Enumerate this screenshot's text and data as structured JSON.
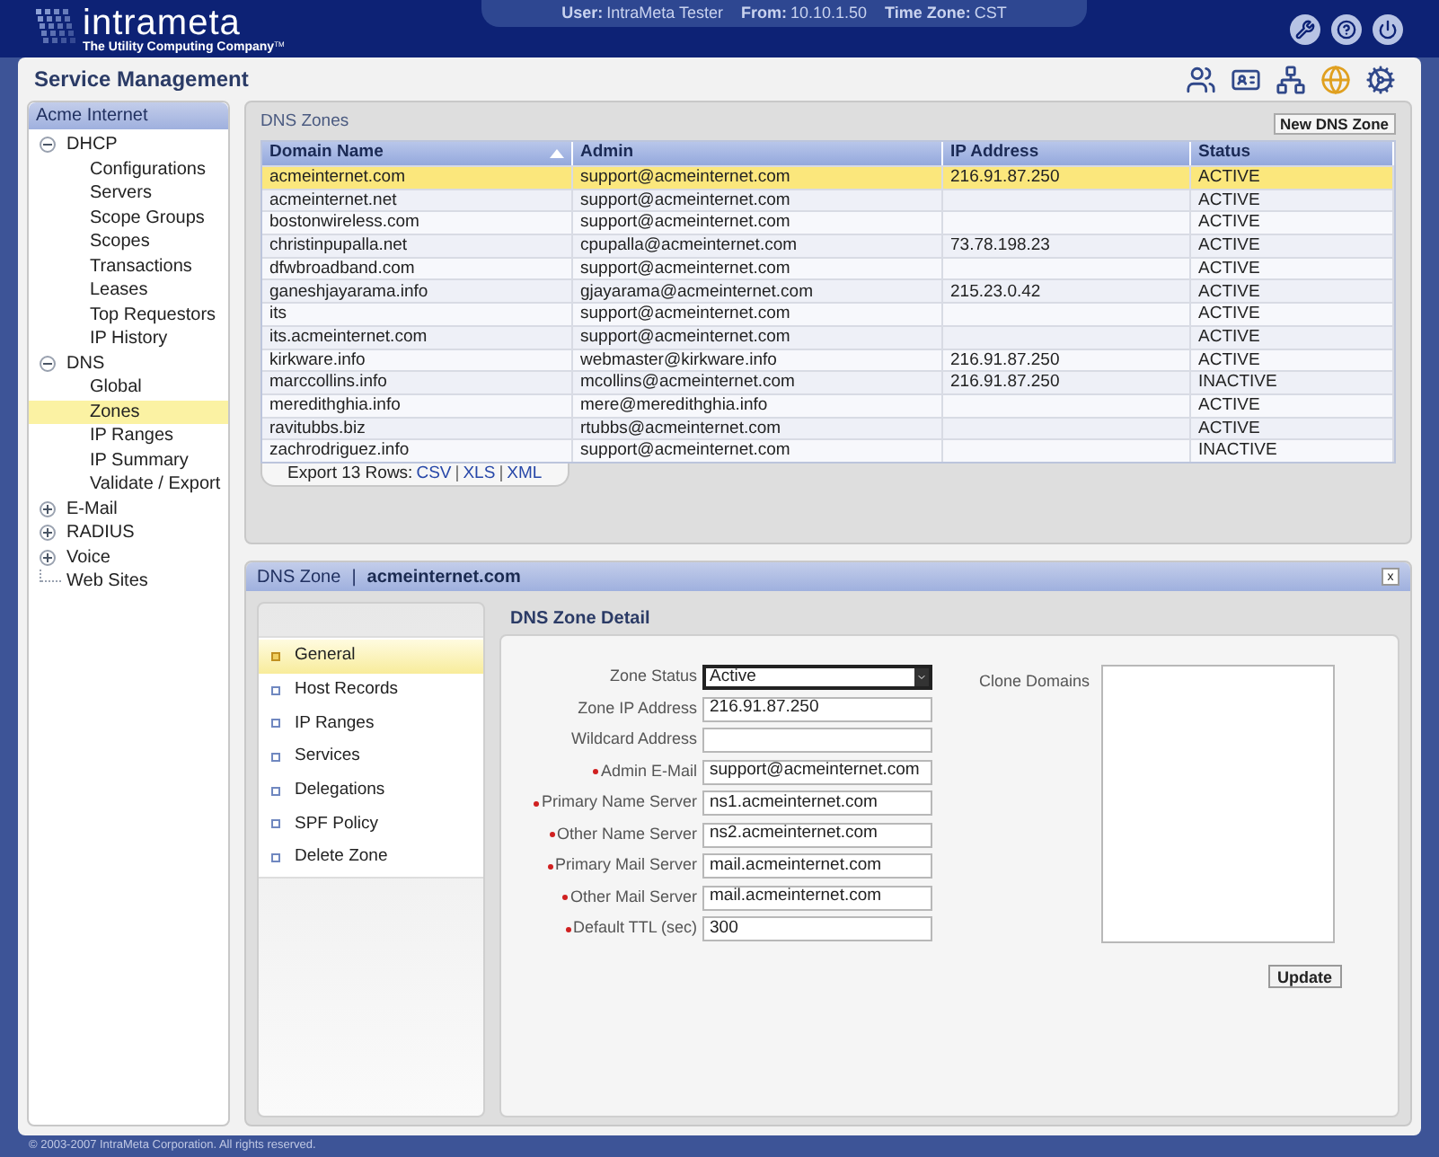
{
  "header": {
    "logo": "intrameta",
    "tagline": "The Utility Computing Company",
    "trademark": "TM",
    "session": [
      {
        "label": "User:",
        "value": "IntraMeta Tester"
      },
      {
        "label": "From:",
        "value": "10.10.1.50"
      },
      {
        "label": "Time Zone:",
        "value": "CST"
      }
    ]
  },
  "page_title": "Service Management",
  "sidebar": {
    "title": "Acme Internet",
    "items": [
      {
        "label": "DHCP",
        "expanded": true,
        "selected": false,
        "children": [
          {
            "label": "Configurations",
            "selected": false
          },
          {
            "label": "Servers",
            "selected": false
          },
          {
            "label": "Scope Groups",
            "selected": false
          },
          {
            "label": "Scopes",
            "selected": false
          },
          {
            "label": "Transactions",
            "selected": false
          },
          {
            "label": "Leases",
            "selected": false
          },
          {
            "label": "Top Requestors",
            "selected": false
          },
          {
            "label": "IP History",
            "selected": false
          }
        ]
      },
      {
        "label": "DNS",
        "expanded": true,
        "selected": false,
        "children": [
          {
            "label": "Global",
            "selected": false
          },
          {
            "label": "Zones",
            "selected": true
          },
          {
            "label": "IP Ranges",
            "selected": false
          },
          {
            "label": "IP Summary",
            "selected": false
          },
          {
            "label": "Validate / Export",
            "selected": false
          }
        ]
      },
      {
        "label": "E-Mail",
        "expanded": false,
        "selected": false
      },
      {
        "label": "RADIUS",
        "expanded": false,
        "selected": false
      },
      {
        "label": "Voice",
        "expanded": false,
        "selected": false
      },
      {
        "label": "Web Sites",
        "selected": false
      }
    ]
  },
  "zones_panel": {
    "title": "DNS Zones",
    "new_button": "New DNS Zone",
    "table": {
      "columns": [
        {
          "label": "Domain Name",
          "sorted": true
        },
        {
          "label": "Admin",
          "sorted": false
        },
        {
          "label": "IP Address",
          "sorted": false
        },
        {
          "label": "Status",
          "sorted": false
        }
      ],
      "rows": [
        {
          "selected": true,
          "cells": [
            "acmeinternet.com",
            "support@acmeinternet.com",
            "216.91.87.250",
            "ACTIVE"
          ]
        },
        {
          "selected": false,
          "cells": [
            "acmeinternet.net",
            "support@acmeinternet.com",
            "",
            "ACTIVE"
          ]
        },
        {
          "selected": false,
          "cells": [
            "bostonwireless.com",
            "support@acmeinternet.com",
            "",
            "ACTIVE"
          ]
        },
        {
          "selected": false,
          "cells": [
            "christinpupalla.net",
            "cpupalla@acmeinternet.com",
            "73.78.198.23",
            "ACTIVE"
          ]
        },
        {
          "selected": false,
          "cells": [
            "dfwbroadband.com",
            "support@acmeinternet.com",
            "",
            "ACTIVE"
          ]
        },
        {
          "selected": false,
          "cells": [
            "ganeshjayarama.info",
            "gjayarama@acmeinternet.com",
            "215.23.0.42",
            "ACTIVE"
          ]
        },
        {
          "selected": false,
          "cells": [
            "its",
            "support@acmeinternet.com",
            "",
            "ACTIVE"
          ]
        },
        {
          "selected": false,
          "cells": [
            "its.acmeinternet.com",
            "support@acmeinternet.com",
            "",
            "ACTIVE"
          ]
        },
        {
          "selected": false,
          "cells": [
            "kirkware.info",
            "webmaster@kirkware.info",
            "216.91.87.250",
            "ACTIVE"
          ]
        },
        {
          "selected": false,
          "cells": [
            "marccollins.info",
            "mcollins@acmeinternet.com",
            "216.91.87.250",
            "INACTIVE"
          ]
        },
        {
          "selected": false,
          "cells": [
            "meredithghia.info",
            "mere@meredithghia.info",
            "",
            "ACTIVE"
          ]
        },
        {
          "selected": false,
          "cells": [
            "ravitubbs.biz",
            "rtubbs@acmeinternet.com",
            "",
            "ACTIVE"
          ]
        },
        {
          "selected": false,
          "cells": [
            "zachrodriguez.info",
            "support@acmeinternet.com",
            "",
            "INACTIVE"
          ]
        }
      ]
    },
    "export": {
      "label": "Export 13 Rows:",
      "links": [
        "CSV",
        "XLS",
        "XML"
      ],
      "separator": "|"
    }
  },
  "detail_panel": {
    "title": "DNS Zone",
    "separator": "|",
    "zone": "acmeinternet.com",
    "close": "x",
    "nav": [
      {
        "label": "General",
        "selected": true
      },
      {
        "label": "Host Records",
        "selected": false
      },
      {
        "label": "IP Ranges",
        "selected": false
      },
      {
        "label": "Services",
        "selected": false
      },
      {
        "label": "Delegations",
        "selected": false
      },
      {
        "label": "SPF Policy",
        "selected": false
      },
      {
        "label": "Delete Zone",
        "selected": false
      }
    ],
    "heading": "DNS Zone Detail",
    "fields": [
      {
        "label": "Zone Status",
        "value": "Active",
        "required": false,
        "kind": "select"
      },
      {
        "label": "Zone IP Address",
        "value": "216.91.87.250",
        "required": false,
        "kind": "text"
      },
      {
        "label": "Wildcard Address",
        "required": false,
        "kind": "text"
      },
      {
        "label": "Admin E-Mail",
        "value": "support@acmeinternet.com",
        "required": true,
        "kind": "text"
      },
      {
        "label": "Primary Name Server",
        "value": "ns1.acmeinternet.com",
        "required": true,
        "kind": "text"
      },
      {
        "label": "Other Name Server",
        "value": "ns2.acmeinternet.com",
        "required": true,
        "kind": "text"
      },
      {
        "label": "Primary Mail Server",
        "value": "mail.acmeinternet.com",
        "required": true,
        "kind": "text"
      },
      {
        "label": "Other Mail Server",
        "value": "mail.acmeinternet.com",
        "required": true,
        "kind": "text"
      },
      {
        "label": "Default TTL (sec)",
        "value": "300",
        "required": true,
        "kind": "text"
      }
    ],
    "clone_label": "Clone Domains",
    "update_button": "Update"
  },
  "footer": "© 2003-2007 IntraMeta Corporation.  All rights reserved."
}
